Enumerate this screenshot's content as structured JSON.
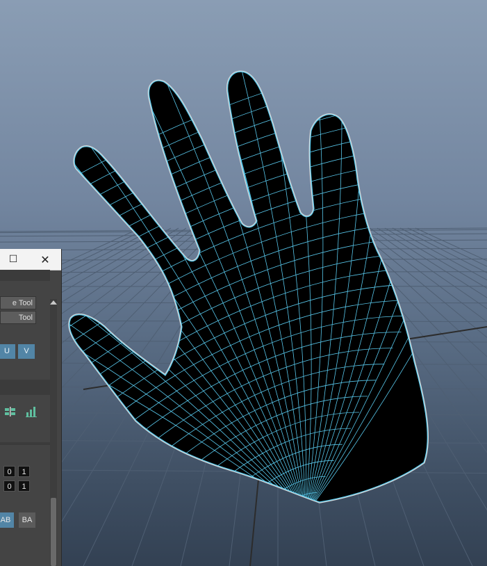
{
  "viewport": {
    "background_top": "#8a9db4",
    "background_bottom": "#334153",
    "grid_color": "#4f5f73",
    "grid_axis_color": "#2c2c2c",
    "mesh_fill": "#000000",
    "mesh_wire": "#58c8ec",
    "selection_outline": "#d8d8d8"
  },
  "tool_window": {
    "title_buttons": {
      "maximize_glyph": "☐",
      "close_glyph": "✕"
    },
    "fields": [
      "e Tool",
      "Tool"
    ],
    "uv_buttons": [
      "U",
      "V"
    ],
    "icon_buttons": [
      "distribute-icon",
      "bar-chart-icon"
    ],
    "range_rows": [
      {
        "min": "0",
        "max": "1"
      },
      {
        "min": "0",
        "max": "1"
      }
    ],
    "order_buttons": [
      "AB",
      "BA"
    ],
    "accent": "#5285a6"
  }
}
